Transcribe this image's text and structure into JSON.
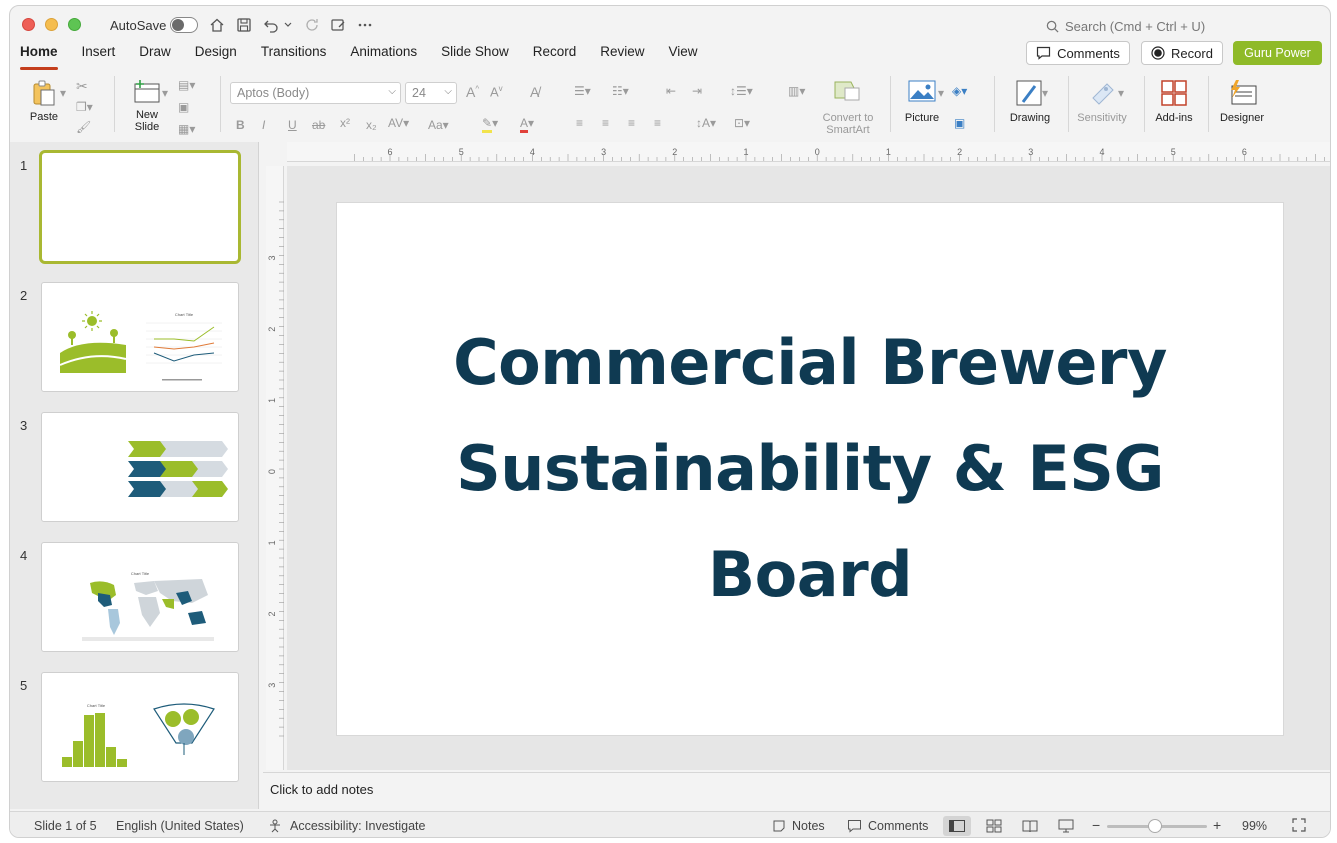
{
  "titlebar": {
    "autosave_label": "AutoSave",
    "search_placeholder": "Search (Cmd + Ctrl + U)"
  },
  "tabs": [
    "Home",
    "Insert",
    "Draw",
    "Design",
    "Transitions",
    "Animations",
    "Slide Show",
    "Record",
    "Review",
    "View"
  ],
  "actions": {
    "comments": "Comments",
    "record": "Record",
    "guru": "Guru Power",
    "guru_color": "#8fba28"
  },
  "ribbon": {
    "paste": "Paste",
    "new_slide_1": "New",
    "new_slide_2": "Slide",
    "font": "Aptos (Body)",
    "size": "24",
    "convert_1": "Convert to",
    "convert_2": "SmartArt",
    "picture": "Picture",
    "drawing": "Drawing",
    "sensitivity": "Sensitivity",
    "addins": "Add-ins",
    "designer": "Designer"
  },
  "thumbnails": [
    "1",
    "2",
    "3",
    "4",
    "5"
  ],
  "thumb_titles": {
    "chart": "Chart Title"
  },
  "slide": {
    "title_line1": "Commercial Brewery",
    "title_line2": "Sustainability & ESG",
    "title_line3": "Board",
    "title_color": "#0f3a52"
  },
  "notes": {
    "placeholder": "Click to add notes"
  },
  "statusbar": {
    "slide_info": "Slide 1 of 5",
    "language": "English (United States)",
    "accessibility": "Accessibility: Investigate",
    "notes": "Notes",
    "comments": "Comments",
    "zoom": "99%"
  },
  "ruler": {
    "h_ticks": [
      "6",
      "5",
      "4",
      "3",
      "2",
      "1",
      "0",
      "1",
      "2",
      "3",
      "4",
      "5",
      "6"
    ],
    "v_ticks": [
      "3",
      "2",
      "1",
      "0",
      "1",
      "2",
      "3"
    ]
  }
}
